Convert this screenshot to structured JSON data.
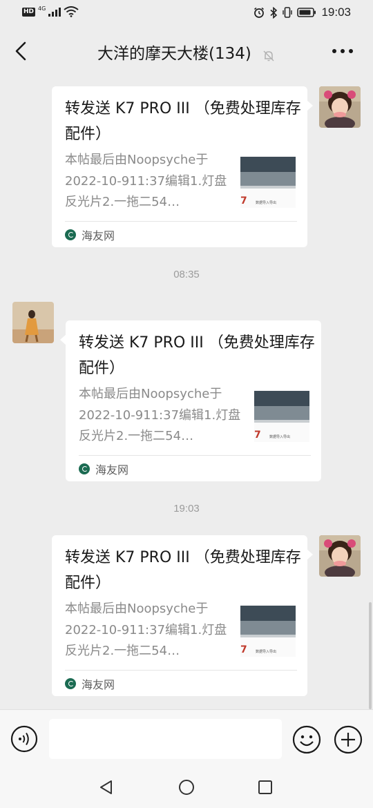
{
  "status_bar": {
    "left_badge": "HD",
    "network": "4G",
    "time": "19:03"
  },
  "header": {
    "title": "大洋的摩天大楼(134)",
    "icons": [
      "back-arrow-icon",
      "mute-bell-icon",
      "more-dots-icon"
    ]
  },
  "card": {
    "title": "转发送 K7 PRO III （免费处理库存配件）",
    "desc": "本帖最后由Noopsyche于2022-10-911:37编辑1.灯盘反光片2.一拖二54…",
    "source": "海友网",
    "thumb_label_1": "7",
    "thumb_label_2": "数据导入导出"
  },
  "messages": [
    {
      "sender": "self"
    },
    {
      "sender": "other"
    },
    {
      "sender": "self"
    }
  ],
  "timestamps": [
    "08:35",
    "19:03"
  ],
  "input_bar": {
    "icons": [
      "voice-icon",
      "emoji-icon",
      "plus-icon"
    ],
    "value": ""
  },
  "nav": {
    "icons": [
      "nav-back-icon",
      "nav-home-icon",
      "nav-recent-icon"
    ]
  },
  "colors": {
    "chat_bg": "#ededed",
    "card_bg": "#ffffff",
    "muted_text": "#8a8a8a",
    "timestamp": "#9b9b9b"
  }
}
